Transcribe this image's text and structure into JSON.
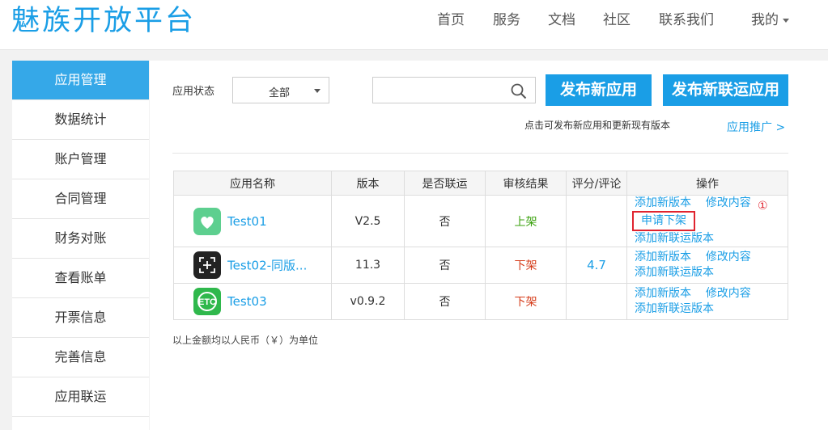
{
  "header": {
    "logo": "魅族开放平台",
    "nav": [
      "首页",
      "服务",
      "文档",
      "社区",
      "联系我们",
      "我的"
    ]
  },
  "sidebar": {
    "items": [
      "应用管理",
      "数据统计",
      "账户管理",
      "合同管理",
      "财务对账",
      "查看账单",
      "开票信息",
      "完善信息",
      "应用联运"
    ]
  },
  "toolbar": {
    "status_label": "应用状态",
    "status_value": "全部",
    "search_value": "",
    "publish_label": "发布新应用",
    "publish_union_label": "发布新联运应用",
    "hint": "点击可发布新应用和更新现有版本",
    "promo": "应用推广 >"
  },
  "table": {
    "headers": [
      "应用名称",
      "版本",
      "是否联运",
      "审核结果",
      "评分/评论",
      "操作"
    ],
    "rows": [
      {
        "name": "Test01",
        "version": "V2.5",
        "union": "否",
        "status": "上架",
        "rating": "",
        "ops": [
          "添加新版本",
          "修改内容",
          "申请下架",
          "添加新联运版本"
        ]
      },
      {
        "name": "Test02-同版...",
        "version": "11.3",
        "union": "否",
        "status": "下架",
        "rating": "4.7",
        "ops": [
          "添加新版本",
          "修改内容",
          "添加新联运版本"
        ]
      },
      {
        "name": "Test03",
        "version": "v0.9.2",
        "union": "否",
        "status": "下架",
        "rating": "",
        "ops": [
          "添加新版本",
          "修改内容",
          "添加新联运版本"
        ]
      }
    ],
    "icon_text_row3": "ETC"
  },
  "annotation": "①",
  "footnote": "以上金额均以人民币（￥）为单位",
  "colors": {
    "accent": "#1a9ee6",
    "approved": "#3aa10e",
    "removed": "#d53c1a",
    "highlight_box": "#e0242f"
  }
}
